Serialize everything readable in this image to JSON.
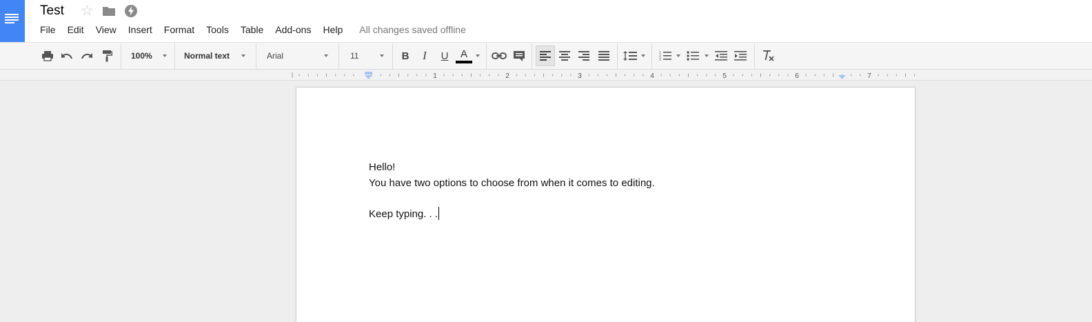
{
  "app": {
    "doc_title": "Test",
    "icons": [
      "docs-logo-icon",
      "star-icon",
      "folder-icon",
      "offline-bolt-icon"
    ]
  },
  "menu": [
    "File",
    "Edit",
    "View",
    "Insert",
    "Format",
    "Tools",
    "Table",
    "Add-ons",
    "Help"
  ],
  "status": "All changes saved offline",
  "toolbar": {
    "zoom": "100%",
    "style": "Normal text",
    "font": "Arial",
    "font_size": "11",
    "bold_label": "B",
    "italic_label": "I",
    "underline_label": "U",
    "text_color_label": "A",
    "text_color": "#000000",
    "active_alignment": "left",
    "icons": [
      "print-icon",
      "undo-icon",
      "redo-icon",
      "paint-format-icon",
      "link-icon",
      "comment-icon",
      "align-left-icon",
      "align-center-icon",
      "align-right-icon",
      "align-justify-icon",
      "line-spacing-icon",
      "numbered-list-icon",
      "bulleted-list-icon",
      "decrease-indent-icon",
      "increase-indent-icon",
      "clear-formatting-icon"
    ]
  },
  "ruler": {
    "labels": [
      "1",
      "2",
      "3",
      "4",
      "5",
      "6",
      "7"
    ],
    "unit": "in"
  },
  "document": {
    "lines": [
      "Hello!",
      "You have two options to choose from when it comes to editing.",
      "",
      "Keep typing. . ."
    ]
  },
  "colors": {
    "brand": "#4285f4",
    "ruler_marker": "#a7c4f0"
  }
}
